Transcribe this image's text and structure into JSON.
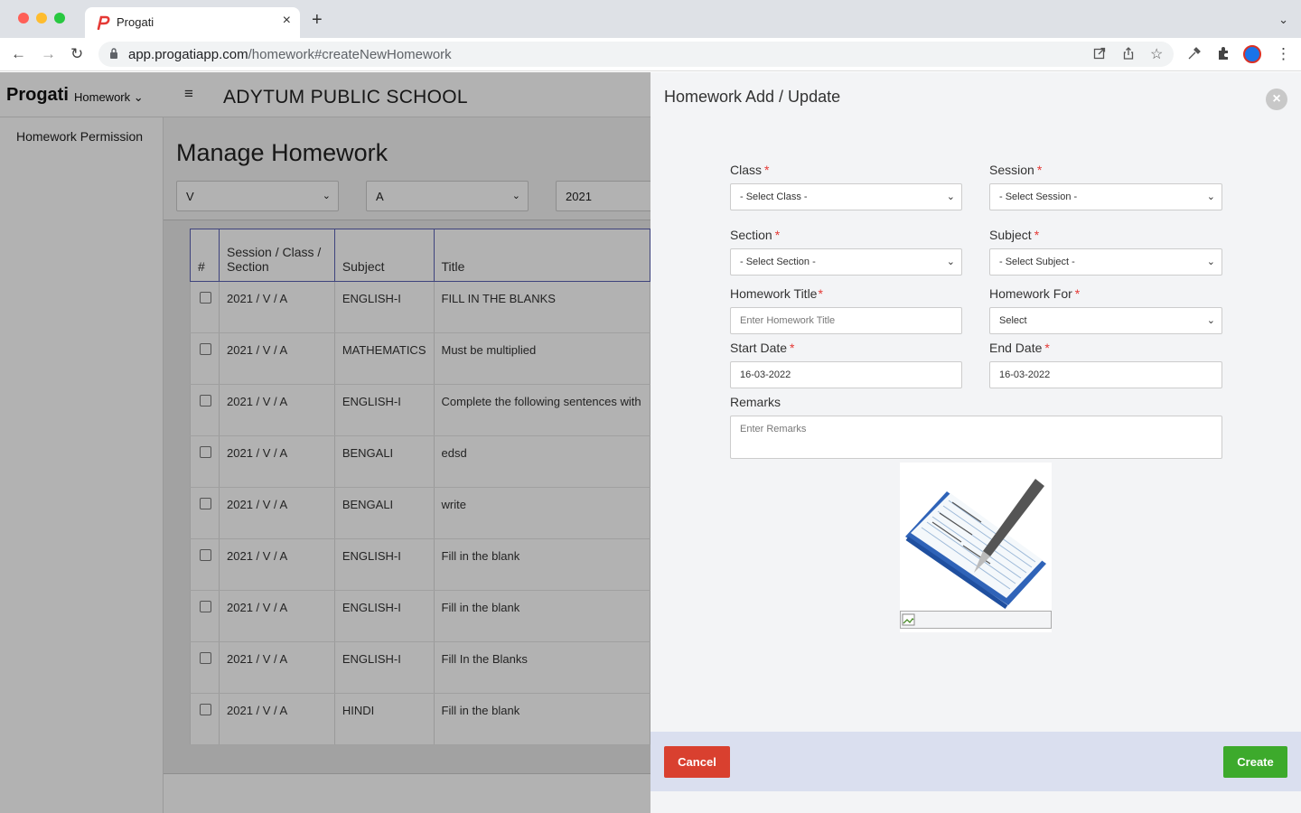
{
  "browser": {
    "tab_title": "Progati",
    "tab_close": "×",
    "new_tab": "+",
    "tab_menu": "⌄",
    "url_host": "app.progatiapp.com",
    "url_path": "/homework#createNewHomework",
    "back": "←",
    "forward": "→",
    "reload": "↻",
    "more": "⋮"
  },
  "app": {
    "brand": "Progati",
    "module": "Homework",
    "module_chevron": "⌄",
    "menu_icon": "≡",
    "school_name": "ADYTUM PUBLIC SCHOOL",
    "sidebar": {
      "items": [
        {
          "label": "Homework Permission"
        }
      ]
    },
    "page_title": "Manage Homework",
    "filters": [
      {
        "value": "V"
      },
      {
        "value": "A"
      },
      {
        "value": "2021"
      }
    ],
    "table": {
      "headers": [
        "#",
        "Session / Class / Section",
        "Subject",
        "Title"
      ],
      "rows": [
        {
          "session": "2021 / V / A",
          "subject": "ENGLISH-I",
          "title": "FILL IN THE BLANKS"
        },
        {
          "session": "2021 / V / A",
          "subject": "MATHEMATICS",
          "title": "Must be multiplied"
        },
        {
          "session": "2021 / V / A",
          "subject": "ENGLISH-I",
          "title": "Complete the following sentences with"
        },
        {
          "session": "2021 / V / A",
          "subject": "BENGALI",
          "title": "edsd"
        },
        {
          "session": "2021 / V / A",
          "subject": "BENGALI",
          "title": "write"
        },
        {
          "session": "2021 / V / A",
          "subject": "ENGLISH-I",
          "title": "Fill in the blank"
        },
        {
          "session": "2021 / V / A",
          "subject": "ENGLISH-I",
          "title": "Fill in the blank"
        },
        {
          "session": "2021 / V / A",
          "subject": "ENGLISH-I",
          "title": "Fill In the Blanks"
        },
        {
          "session": "2021 / V / A",
          "subject": "HINDI",
          "title": "Fill in the blank"
        }
      ]
    }
  },
  "panel": {
    "title": "Homework Add / Update",
    "close_icon": "×",
    "required_mark": "*",
    "fields": {
      "class": {
        "label": "Class",
        "value": "- Select Class -"
      },
      "session": {
        "label": "Session",
        "value": "- Select Session -"
      },
      "section": {
        "label": "Section",
        "value": "- Select Section -"
      },
      "subject": {
        "label": "Subject",
        "value": "- Select Subject -"
      },
      "homework_title": {
        "label": "Homework Title",
        "placeholder": "Enter Homework Title"
      },
      "homework_for": {
        "label": "Homework For",
        "value": "Select"
      },
      "start_date": {
        "label": "Start Date",
        "value": "16-03-2022"
      },
      "end_date": {
        "label": "End Date",
        "value": "16-03-2022"
      },
      "remarks": {
        "label": "Remarks",
        "placeholder": "Enter Remarks"
      }
    },
    "cancel_label": "Cancel",
    "create_label": "Create"
  },
  "colors": {
    "cancel": "#d9402f",
    "create": "#3daa2c",
    "footer_bg": "#dadfef",
    "table_header_border": "#5961b3"
  }
}
